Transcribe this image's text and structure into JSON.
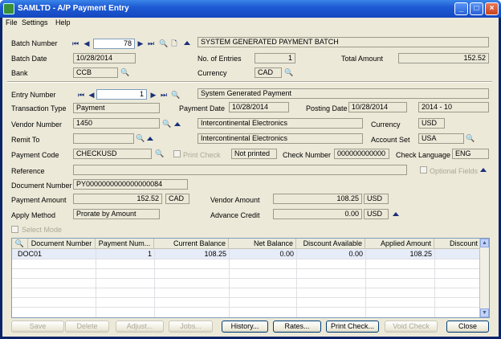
{
  "window": {
    "title": "SAMLTD - A/P Payment Entry"
  },
  "menu": [
    "File",
    "Settings",
    "Help"
  ],
  "batch": {
    "number_label": "Batch Number",
    "number": "78",
    "description": "SYSTEM GENERATED PAYMENT BATCH",
    "date_label": "Batch Date",
    "date": "10/28/2014",
    "entries_label": "No. of Entries",
    "entries": "1",
    "total_label": "Total Amount",
    "total": "152.52",
    "bank_label": "Bank",
    "bank": "CCB",
    "currency_label": "Currency",
    "currency": "CAD"
  },
  "entry": {
    "number_label": "Entry Number",
    "number": "1",
    "description": "System Generated Payment",
    "trans_type_label": "Transaction Type",
    "trans_type": "Payment",
    "payment_date_label": "Payment Date",
    "payment_date": "10/28/2014",
    "posting_date_label": "Posting Date",
    "posting_date": "10/28/2014",
    "period": "2014 - 10",
    "vendor_label": "Vendor Number",
    "vendor": "1450",
    "vendor_name": "Intercontinental Electronics",
    "vcur_label": "Currency",
    "vcur": "USD",
    "remit_label": "Remit To",
    "remit": "",
    "remit_name": "Intercontinental Electronics",
    "acctset_label": "Account Set",
    "acctset": "USA",
    "paycode_label": "Payment Code",
    "paycode": "CHECKUSD",
    "printcheck_label": "Print Check",
    "printstatus": "Not printed",
    "checknum_label": "Check Number",
    "checknum": "000000000000",
    "checklang_label": "Check Language",
    "checklang": "ENG",
    "reference_label": "Reference",
    "reference": "",
    "optfields_label": "Optional Fields",
    "docnum_label": "Document Number",
    "docnum": "PY0000000000000000084",
    "payamt_label": "Payment Amount",
    "payamt": "152.52",
    "paycur": "CAD",
    "vendamt_label": "Vendor Amount",
    "vendamt": "108.25",
    "vendcur": "USD",
    "apply_label": "Apply Method",
    "apply": "Prorate by Amount",
    "advcredit_label": "Advance Credit",
    "advcredit": "0.00",
    "advcur": "USD",
    "selectmode_label": "Select Mode"
  },
  "grid": {
    "columns": [
      "Document Number",
      "Payment Num...",
      "Current Balance",
      "Net Balance",
      "Discount Available",
      "Applied Amount",
      "Discount"
    ],
    "rows": [
      [
        "DOC01",
        "1",
        "108.25",
        "0.00",
        "0.00",
        "108.25",
        ""
      ]
    ]
  },
  "buttons": {
    "save": "Save",
    "delete": "Delete",
    "adjust": "Adjust...",
    "jobs": "Jobs...",
    "history": "History...",
    "rates": "Rates...",
    "printcheck": "Print Check...",
    "voidcheck": "Void Check",
    "close": "Close"
  }
}
